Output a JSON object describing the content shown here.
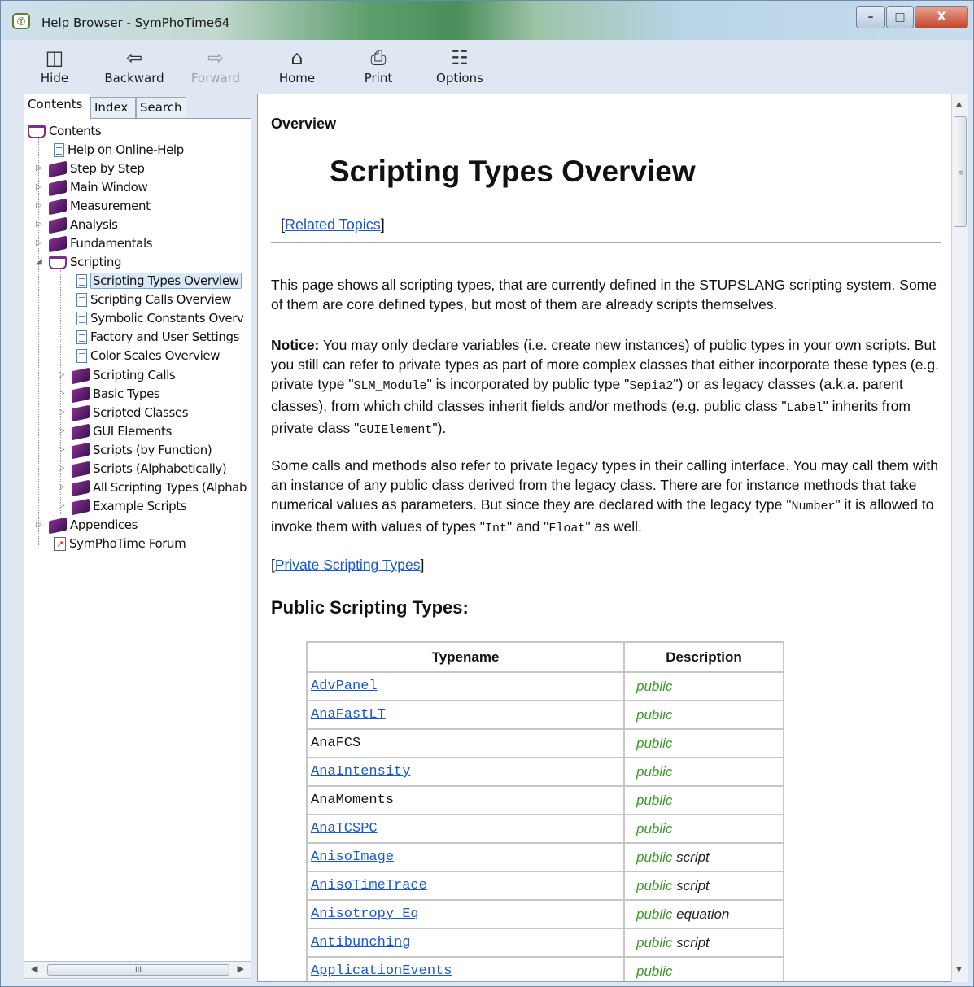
{
  "window": {
    "title": "Help Browser - SymPhoTime64",
    "app_icon_text": "Ⓣ",
    "controls": {
      "minimize": "–",
      "maximize": "□",
      "close": "X"
    }
  },
  "toolbar": {
    "items": [
      {
        "label": "Hide",
        "icon": "hide-icon",
        "enabled": true
      },
      {
        "label": "Backward",
        "icon": "back-arrow-icon",
        "enabled": true
      },
      {
        "label": "Forward",
        "icon": "forward-arrow-icon",
        "enabled": false
      },
      {
        "label": "Home",
        "icon": "home-icon",
        "enabled": true
      },
      {
        "label": "Print",
        "icon": "printer-icon",
        "enabled": true
      },
      {
        "label": "Options",
        "icon": "options-icon",
        "enabled": true
      }
    ]
  },
  "nav": {
    "tabs": [
      "Contents",
      "Index",
      "Search"
    ],
    "active_tab": "Contents",
    "tree": [
      {
        "label": "Contents",
        "type": "book-open",
        "expanded": true
      },
      {
        "label": "Help on Online-Help",
        "type": "page"
      },
      {
        "label": "Step by Step",
        "type": "book"
      },
      {
        "label": "Main Window",
        "type": "book"
      },
      {
        "label": "Measurement",
        "type": "book"
      },
      {
        "label": "Analysis",
        "type": "book"
      },
      {
        "label": "Fundamentals",
        "type": "book"
      },
      {
        "label": "Scripting",
        "type": "book-open",
        "expanded": true
      },
      {
        "label": "Scripting Types Overview",
        "type": "page",
        "selected": true
      },
      {
        "label": "Scripting Calls Overview",
        "type": "page"
      },
      {
        "label": "Symbolic Constants Overv",
        "type": "page"
      },
      {
        "label": "Factory and User Settings",
        "type": "page"
      },
      {
        "label": "Color Scales Overview",
        "type": "page"
      },
      {
        "label": "Scripting Calls",
        "type": "book"
      },
      {
        "label": "Basic Types",
        "type": "book"
      },
      {
        "label": "Scripted Classes",
        "type": "book"
      },
      {
        "label": "GUI Elements",
        "type": "book"
      },
      {
        "label": "Scripts (by Function)",
        "type": "book"
      },
      {
        "label": "Scripts (Alphabetically)",
        "type": "book"
      },
      {
        "label": "All Scripting Types (Alphab",
        "type": "book"
      },
      {
        "label": "Example Scripts",
        "type": "book"
      },
      {
        "label": "Appendices",
        "type": "book"
      },
      {
        "label": "SymPhoTime Forum",
        "type": "link"
      }
    ],
    "hscroll_grip": "III"
  },
  "content": {
    "section_label": "Overview",
    "title": "Scripting Types Overview",
    "related_link": "Related Topics",
    "para1": "This page shows all scripting types, that are currently defined in the STUPSLANG scripting system. Some of them are core defined types, but most of them are already scripts themselves.",
    "notice_label": "Notice:",
    "notice_pre": " You may only declare variables (i.e. create new instances) of public types in your own scripts. But you still can refer to private types as part of more complex classes that either incorporate these types (e.g. private type \"",
    "notice_code1": "SLM_Module",
    "notice_mid1": "\" is incorporated by public type \"",
    "notice_code2": "Sepia2",
    "notice_mid2": "\") or as legacy classes (a.k.a. parent classes), from which child classes inherit fields and/or methods (e.g. public class \"",
    "notice_code3": "Label",
    "notice_mid3": "\" inherits from private class \"",
    "notice_code4": "GUIElement",
    "notice_end": "\").",
    "para3_pre": "Some calls and methods also refer to private legacy types in their calling interface. You may call them with an instance of any public class derived from the legacy class. There are for instance methods that take numerical values as parameters. But since they are declared with the legacy type \"",
    "para3_code1": "Number",
    "para3_mid": "\" it is allowed to invoke them with values of types \"",
    "para3_code2": "Int",
    "para3_and": "\" and \"",
    "para3_code3": "Float",
    "para3_end": "\" as well.",
    "private_link": "Private Scripting Types",
    "public_heading": "Public Scripting Types:",
    "table_headers": [
      "Typename",
      "Description"
    ],
    "table_rows": [
      {
        "name": "AdvPanel",
        "link": true,
        "vis": "public",
        "kind": ""
      },
      {
        "name": "AnaFastLT",
        "link": true,
        "vis": "public",
        "kind": ""
      },
      {
        "name": "AnaFCS",
        "link": false,
        "vis": "public",
        "kind": ""
      },
      {
        "name": "AnaIntensity",
        "link": true,
        "vis": "public",
        "kind": ""
      },
      {
        "name": "AnaMoments",
        "link": false,
        "vis": "public",
        "kind": ""
      },
      {
        "name": "AnaTCSPC",
        "link": true,
        "vis": "public",
        "kind": ""
      },
      {
        "name": "AnisoImage",
        "link": true,
        "vis": "public",
        "kind": "script"
      },
      {
        "name": "AnisoTimeTrace",
        "link": true,
        "vis": "public",
        "kind": "script"
      },
      {
        "name": "Anisotropy_Eq",
        "link": true,
        "vis": "public",
        "kind": "equation"
      },
      {
        "name": "Antibunching",
        "link": true,
        "vis": "public",
        "kind": "script"
      },
      {
        "name": "ApplicationEvents",
        "link": true,
        "vis": "public",
        "kind": ""
      }
    ]
  }
}
